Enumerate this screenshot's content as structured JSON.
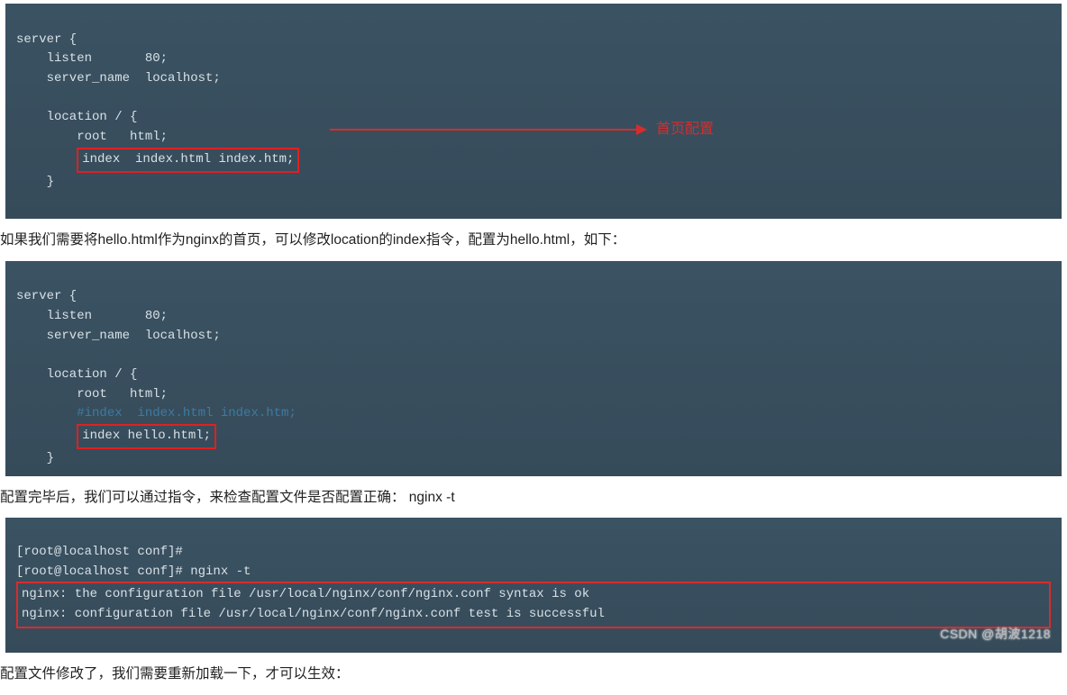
{
  "block1": {
    "l1": "server {",
    "l2": "    listen       80;",
    "l3": "    server_name  localhost;",
    "l4": "",
    "l5": "    location / {",
    "l6": "        root   html;",
    "l7_boxed": "index  index.html index.htm;",
    "l8": "    }",
    "arrow_label": "首页配置"
  },
  "para1": "如果我们需要将hello.html作为nginx的首页，可以修改location的index指令，配置为hello.html，如下：",
  "block2": {
    "l1": "server {",
    "l2": "    listen       80;",
    "l3": "    server_name  localhost;",
    "l4": "",
    "l5": "    location / {",
    "l6": "        root   html;",
    "l7_comment": "        #index  index.html index.htm;",
    "l8_boxed": "index hello.html;",
    "l9": "    }"
  },
  "para2": "配置完毕后，我们可以通过指令，来检查配置文件是否配置正确： nginx -t",
  "block3": {
    "l1": "[root@localhost conf]#",
    "l2": "[root@localhost conf]# nginx -t",
    "l3_boxed": "nginx: the configuration file /usr/local/nginx/conf/nginx.conf syntax is ok",
    "l4_boxed": "nginx: configuration file /usr/local/nginx/conf/nginx.conf test is successful"
  },
  "para3": "配置文件修改了，我们需要重新加载一下，才可以生效：",
  "watermark": "CSDN @胡波1218"
}
